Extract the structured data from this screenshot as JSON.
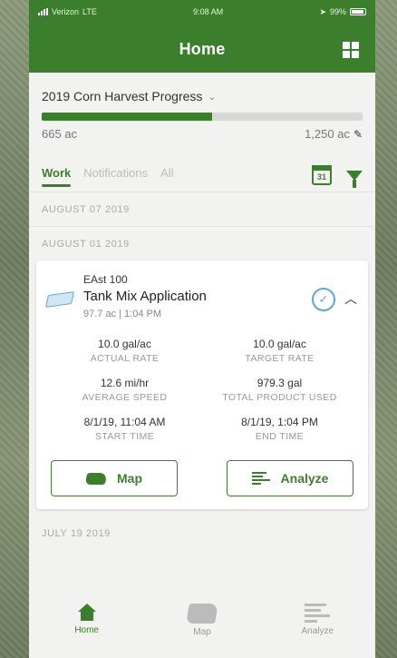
{
  "status_bar": {
    "carrier": "Verizon",
    "network": "LTE",
    "time": "9:08 AM",
    "battery": "99%"
  },
  "app_bar": {
    "title": "Home"
  },
  "progress": {
    "title": "2019 Corn Harvest Progress",
    "current_label": "665 ac",
    "target_label": "1,250 ac",
    "fraction": 0.532
  },
  "tabs": [
    {
      "label": "Work",
      "active": true
    },
    {
      "label": "Notifications",
      "active": false
    },
    {
      "label": "All",
      "active": false
    }
  ],
  "calendar_icon_day": "31",
  "date_groups": [
    "AUGUST 07 2019",
    "AUGUST 01 2019",
    "JULY 19 2019"
  ],
  "card": {
    "field": "EAst 100",
    "operation": "Tank Mix Application",
    "meta": "97.7 ac | 1:04 PM",
    "stats": [
      {
        "value": "10.0 gal/ac",
        "label": "ACTUAL RATE"
      },
      {
        "value": "10.0 gal/ac",
        "label": "TARGET RATE"
      },
      {
        "value": "12.6 mi/hr",
        "label": "AVERAGE SPEED"
      },
      {
        "value": "979.3 gal",
        "label": "TOTAL PRODUCT USED"
      },
      {
        "value": "8/1/19, 11:04 AM",
        "label": "START TIME"
      },
      {
        "value": "8/1/19, 1:04 PM",
        "label": "END TIME"
      }
    ],
    "map_button": "Map",
    "analyze_button": "Analyze"
  },
  "bottom_nav": [
    {
      "label": "Home",
      "icon": "home-icon",
      "active": true
    },
    {
      "label": "Map",
      "icon": "map-icon",
      "active": false
    },
    {
      "label": "Analyze",
      "icon": "analyze-icon",
      "active": false
    }
  ],
  "colors": {
    "primary": "#3b7f2c",
    "accent": "#5aa9d4"
  }
}
